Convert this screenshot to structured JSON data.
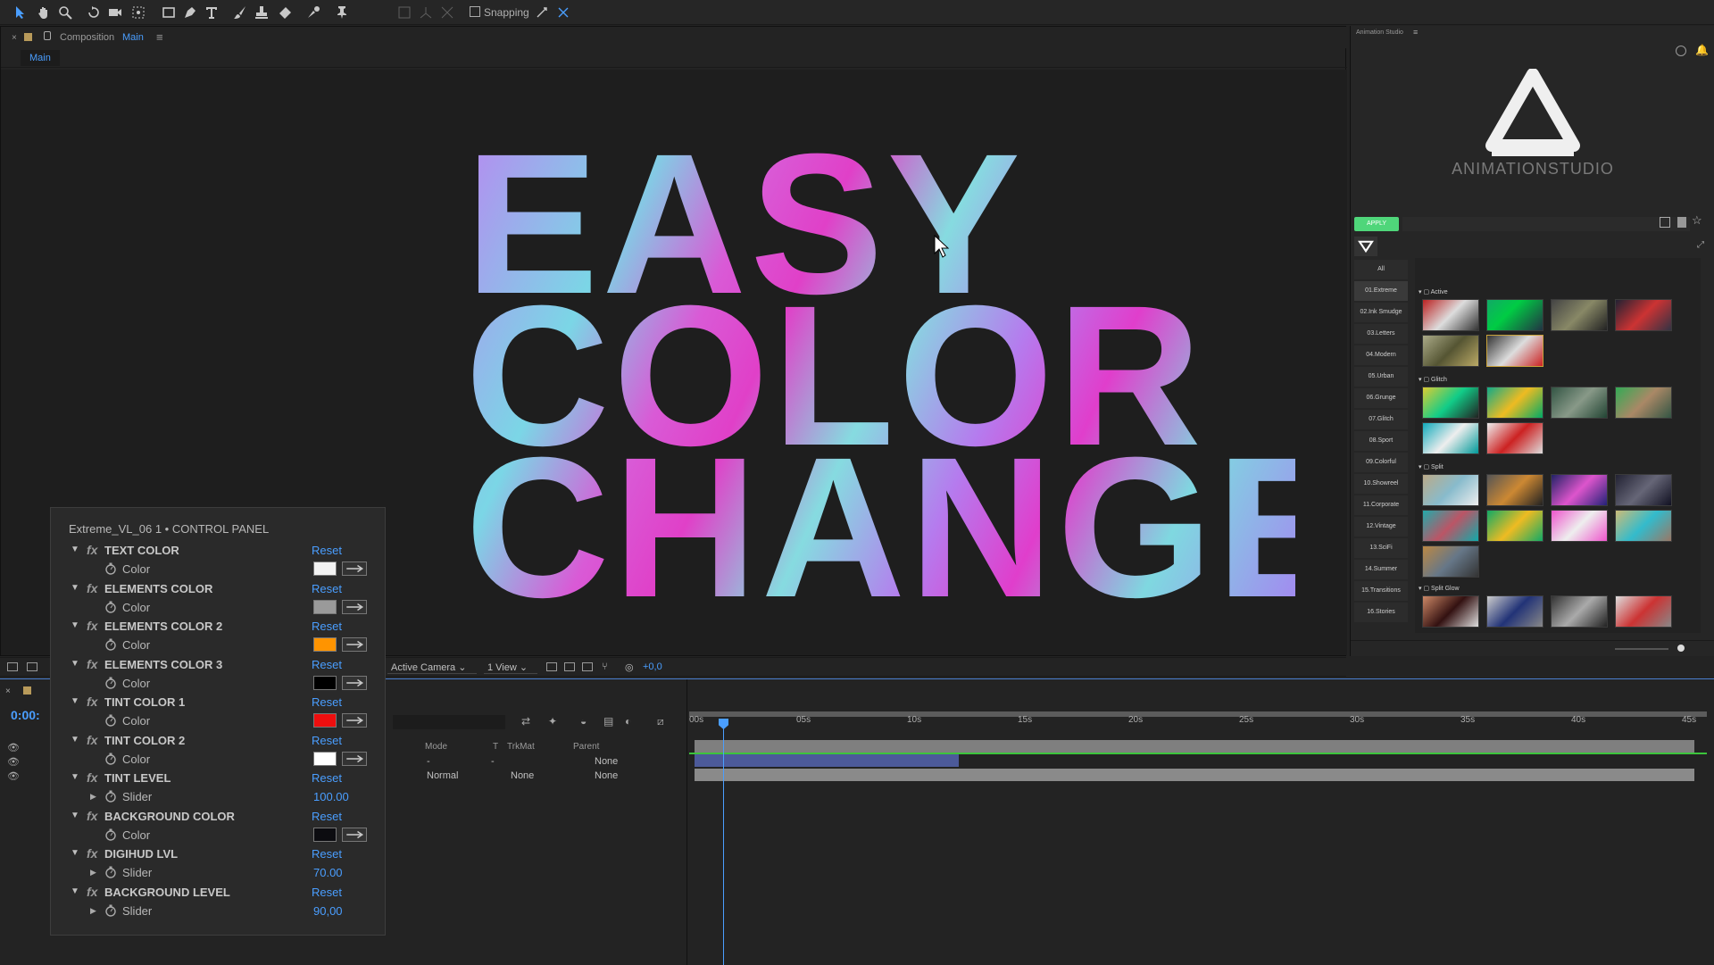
{
  "toolbar": {
    "snapping_label": "Snapping",
    "tools": [
      "selection-tool",
      "hand-tool",
      "zoom-tool",
      "rotate-tool",
      "camera-tool",
      "pan-behind-tool",
      "rectangle-tool",
      "pen-tool",
      "type-tool",
      "brush-tool",
      "clone-stamp-tool",
      "eraser-tool",
      "roto-brush-tool",
      "puppet-pin-tool"
    ]
  },
  "composition": {
    "tab_prefix": "Composition",
    "tab_name": "Main",
    "sub_tab": "Main",
    "headline": [
      "EASY",
      "COLOR",
      "CHANGE"
    ],
    "bottom_bar": {
      "camera": "Active Camera",
      "views": "1 View",
      "exposure": "+0,0"
    }
  },
  "right_panel": {
    "title": "Animation Studio",
    "logo_text": "ANIMATIONSTUDIO",
    "apply_label": "APPLY",
    "categories": [
      "All",
      "01.Extreme",
      "02.Ink Smudge",
      "03.Letters",
      "04.Modern",
      "05.Urban",
      "06.Grunge",
      "07.Glitch",
      "08.Sport",
      "09.Colorful",
      "10.Showreel",
      "11.Corporate",
      "12.Vintage",
      "13.SciFi",
      "14.Summer",
      "15.Transitions",
      "16.Stories"
    ],
    "sections": [
      "Active",
      "Glitch",
      "Split",
      "Split Glow"
    ]
  },
  "control_panel": {
    "title": "Extreme_VL_06 1 • CONTROL PANEL",
    "reset_label": "Reset",
    "effects": [
      {
        "name": "TEXT COLOR",
        "sub": "Color",
        "type": "color",
        "color": "#f2f2f2"
      },
      {
        "name": "ELEMENTS COLOR",
        "sub": "Color",
        "type": "color",
        "color": "#9a9a9a"
      },
      {
        "name": "ELEMENTS COLOR 2",
        "sub": "Color",
        "type": "color",
        "color": "#ff9400"
      },
      {
        "name": "ELEMENTS COLOR 3",
        "sub": "Color",
        "type": "color",
        "color": "#000000"
      },
      {
        "name": "TINT COLOR 1",
        "sub": "Color",
        "type": "color",
        "color": "#ee0e0e"
      },
      {
        "name": "TINT COLOR 2",
        "sub": "Color",
        "type": "color",
        "color": "#ffffff"
      },
      {
        "name": "TINT LEVEL",
        "sub": "Slider",
        "type": "slider",
        "value": "100.00"
      },
      {
        "name": "BACKGROUND COLOR",
        "sub": "Color",
        "type": "color",
        "color": "#0c0c10"
      },
      {
        "name": "DIGIHUD LVL",
        "sub": "Slider",
        "type": "slider",
        "value": "70.00"
      },
      {
        "name": "BACKGROUND LEVEL",
        "sub": "Slider",
        "type": "slider",
        "value": "90,00"
      }
    ]
  },
  "timeline": {
    "time_code": "0:00:",
    "columns": {
      "mode": "Mode",
      "t": "T",
      "trkmat": "TrkMat",
      "parent": "Parent"
    },
    "rows": [
      {
        "mode": "-",
        "trkmat": "-",
        "parent": "None"
      },
      {
        "mode": "Normal",
        "trkmat": "None",
        "parent": "None"
      }
    ],
    "ruler": [
      "00s",
      "05s",
      "10s",
      "15s",
      "20s",
      "25s",
      "30s",
      "35s",
      "40s",
      "45s"
    ]
  }
}
